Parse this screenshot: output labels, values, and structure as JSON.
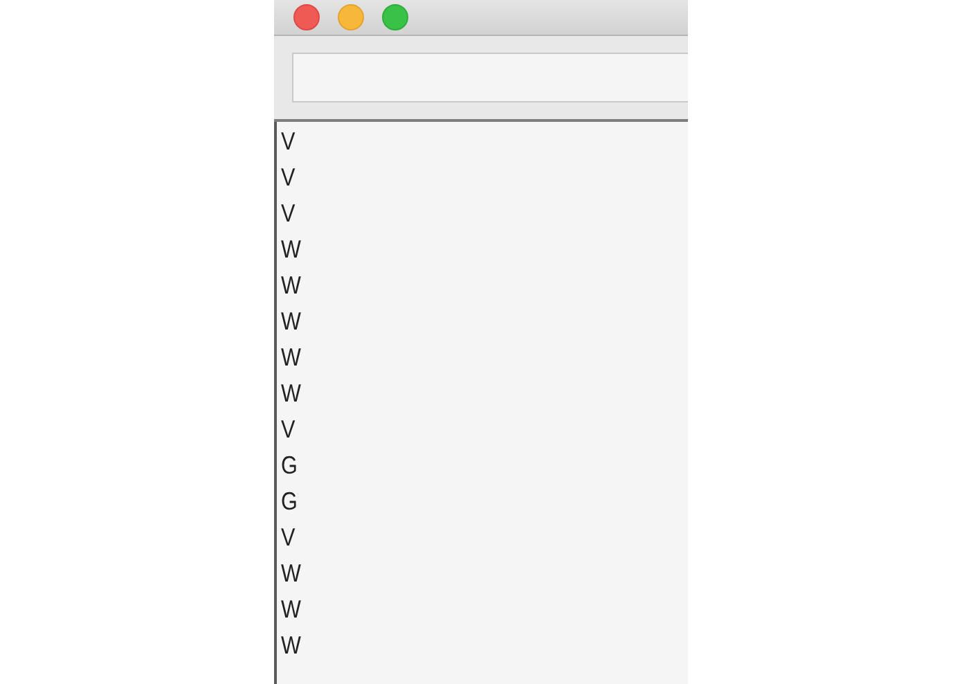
{
  "list": {
    "items": [
      "V",
      "V",
      "V",
      "W",
      "W",
      "W",
      "W",
      "W",
      "V",
      "G",
      "G",
      "V",
      "W",
      "W",
      "W"
    ]
  }
}
